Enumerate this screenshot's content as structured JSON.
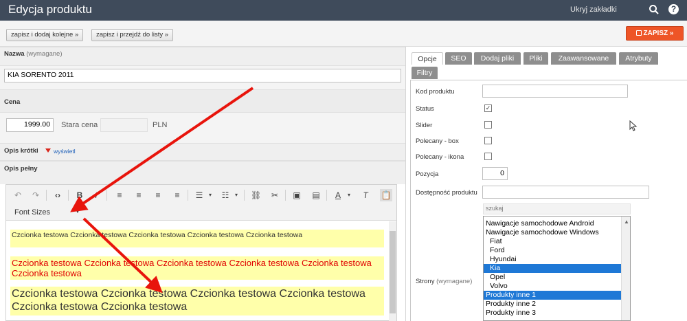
{
  "header": {
    "title": "Edycja produktu",
    "hide_tabs": "Ukryj zakładki"
  },
  "actions": {
    "save_add": "zapisz i dodaj kolejne »",
    "save_list": "zapisz i przejdź do listy »",
    "save": "ZAPISZ »"
  },
  "form": {
    "name_label": "Nazwa",
    "name_required": "(wymagane)",
    "name_value": "KIA SORENTO 2011",
    "price_label": "Cena",
    "price_value": "1999.00",
    "old_price_label": "Stara cena",
    "currency": "PLN",
    "short_desc_label": "Opis krótki",
    "show_link": "wyświetl",
    "full_desc_label": "Opis pełny"
  },
  "editor": {
    "font_sizes": "Font Sizes",
    "lines": [
      "Czcionka testowa Czcionka testowa Czcionka testowa Czcionka testowa Czcionka testowa",
      "Czcionka testowa Czcionka testowa Czcionka testowa Czcionka testowa Czcionka testowa Czcionka testowa",
      "Czcionka testowa Czcionka testowa Czcionka testowa Czcionka testowa Czcionka testowa Czcionka testowa"
    ],
    "line_colors": [
      "#000000",
      "#e00000",
      "#000000"
    ]
  },
  "tabs": [
    "Opcje",
    "SEO",
    "Dodaj pliki",
    "Pliki",
    "Zaawansowane",
    "Atrybuty",
    "Filtry"
  ],
  "options": {
    "product_code": "Kod produktu",
    "status": "Status",
    "slider": "Slider",
    "featured_box": "Polecany - box",
    "featured_icon": "Polecany - ikona",
    "position": "Pozycja",
    "position_value": "0",
    "availability": "Dostępność produktu",
    "search_placeholder": "szukaj",
    "pages_label": "Strony",
    "pages_required": "(wymagane)",
    "pages": [
      "Nawigacje samochodowe Android",
      "Nawigacje samochodowe Windows",
      "Fiat",
      "Ford",
      "Hyundai",
      "Kia",
      "Opel",
      "Volvo",
      "Produkty inne 1",
      "Produkty inne 2",
      "Produkty inne 3"
    ]
  },
  "colors": {
    "header_bg": "#3f4b5b",
    "save_btn": "#ee5527",
    "selected": "#1e78d6",
    "annotation_arrow": "#e8140c"
  }
}
